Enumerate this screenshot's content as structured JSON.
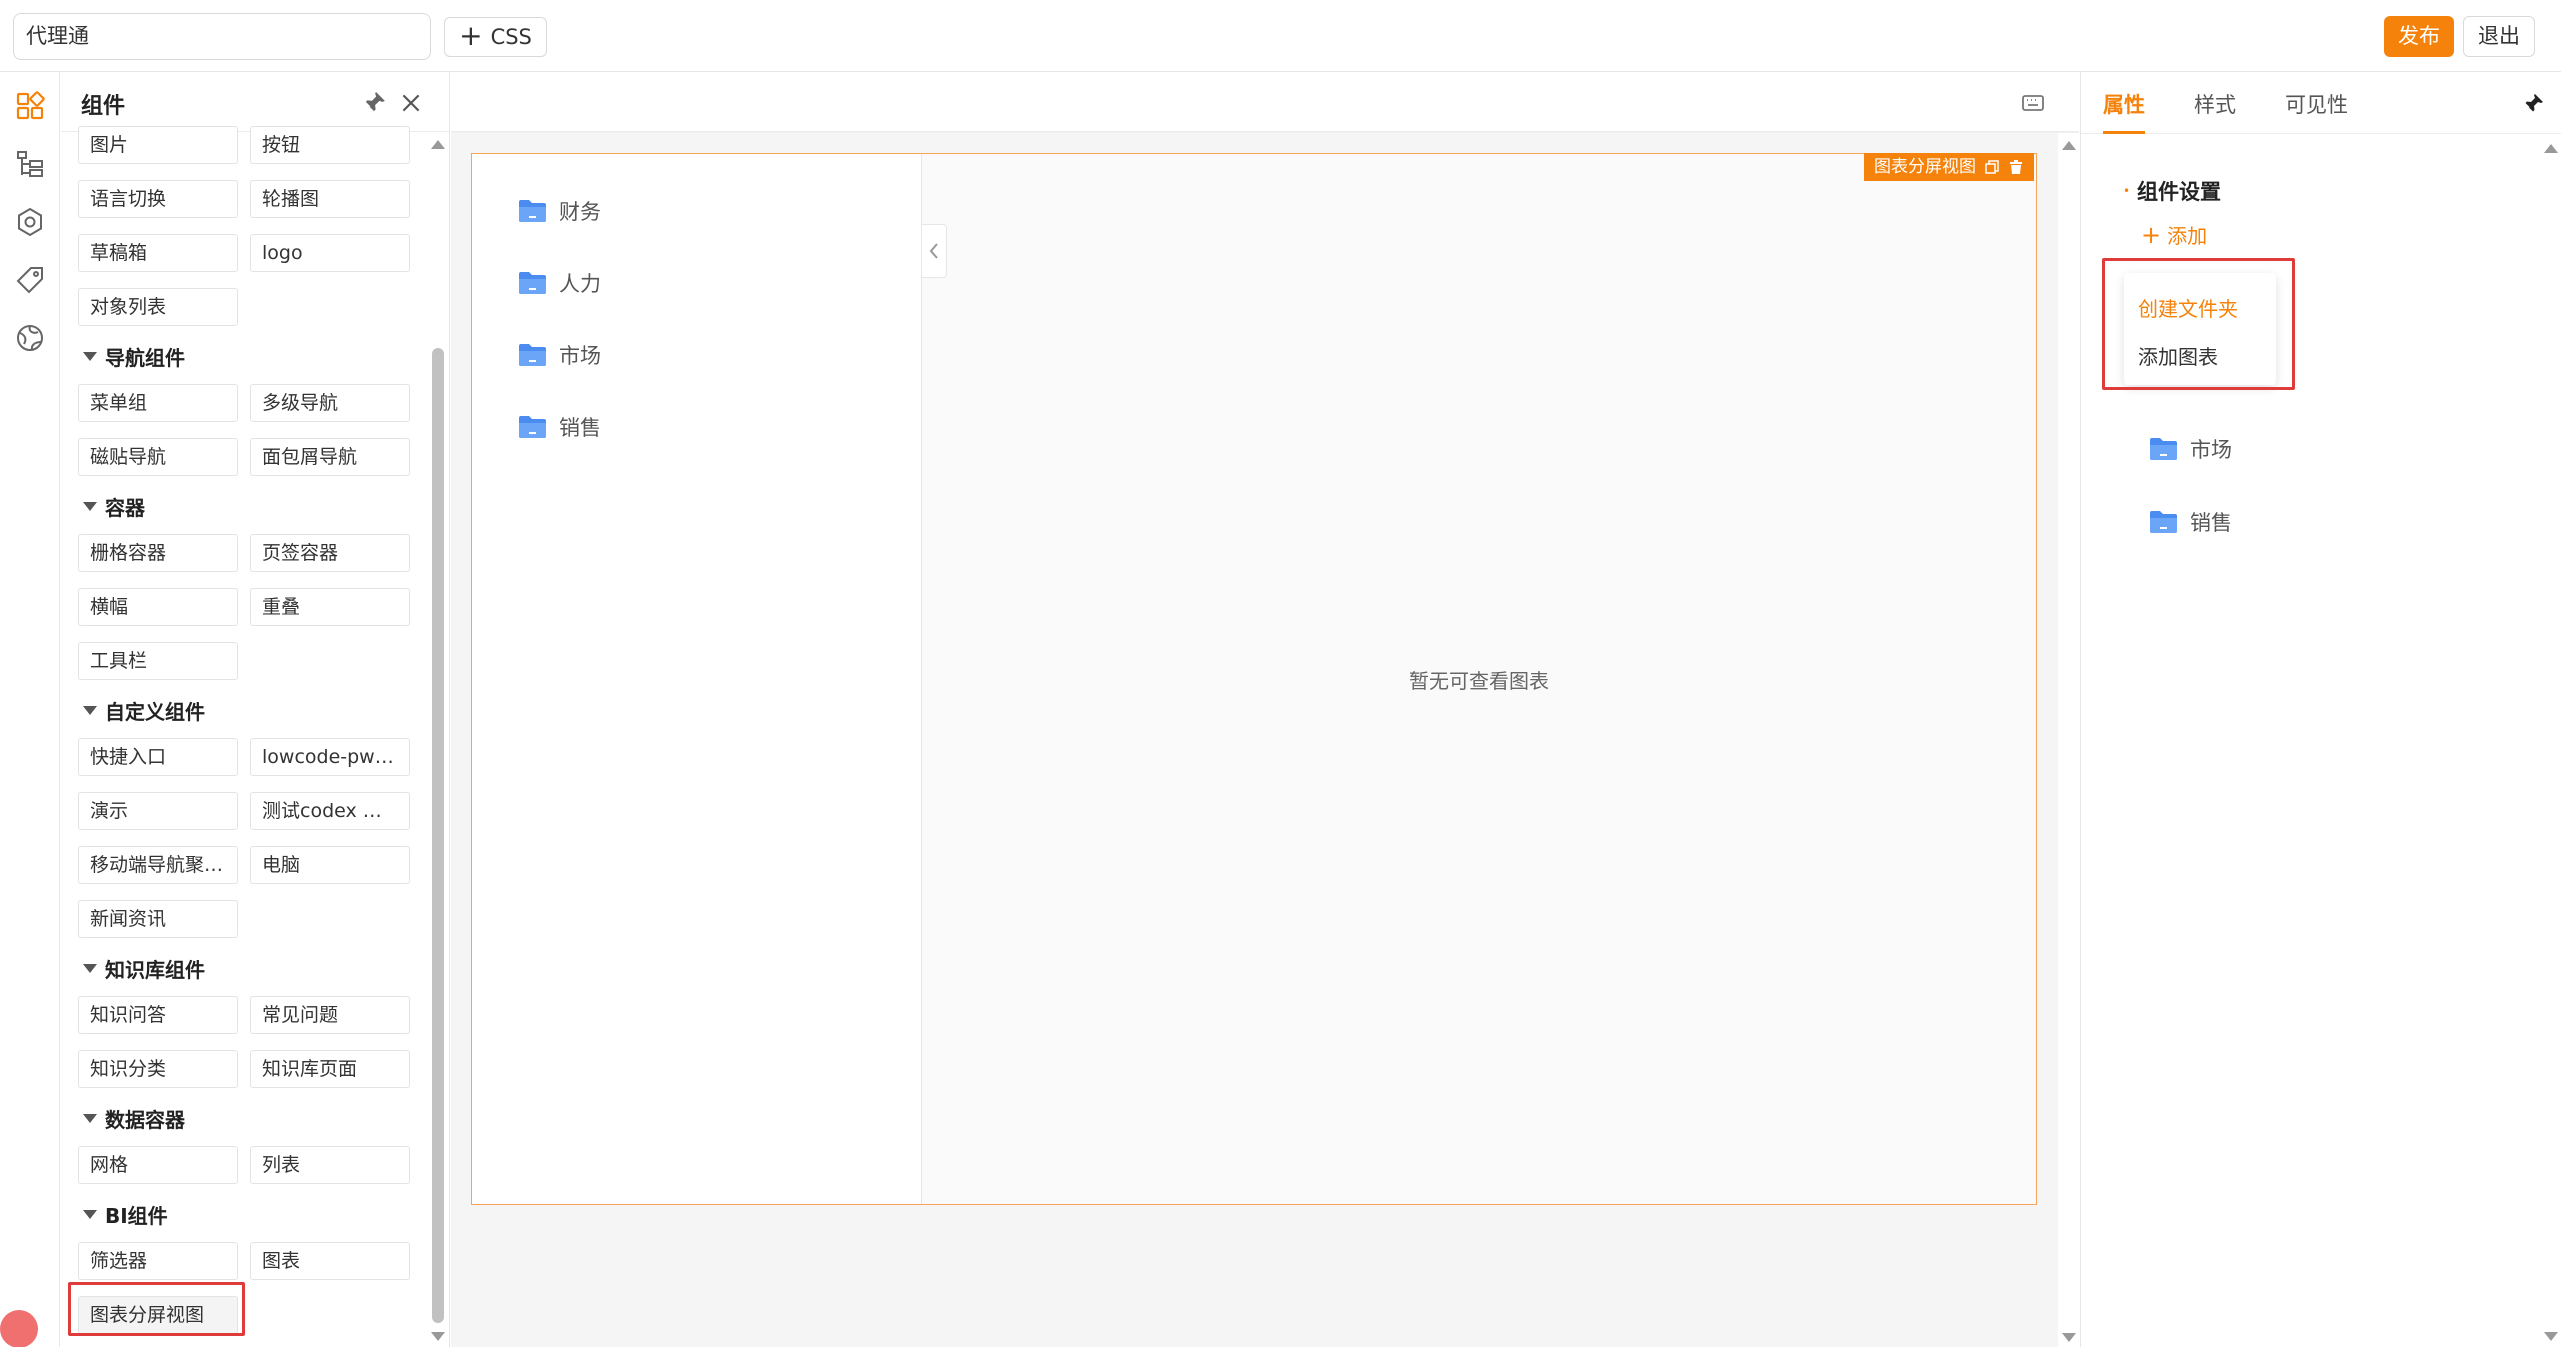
{
  "header": {
    "app_name": "代理通",
    "css_label": "CSS",
    "publish_label": "发布",
    "exit_label": "退出"
  },
  "rail": {
    "icons": [
      "components-icon",
      "tree-icon",
      "settings-hex-icon",
      "tag-icon",
      "globe-icon"
    ]
  },
  "panel": {
    "title": "组件",
    "top_items": [
      "图片",
      "按钮",
      "语言切换",
      "轮播图",
      "草稿箱",
      "logo",
      "对象列表"
    ],
    "groups": [
      {
        "title": "导航组件",
        "items": [
          "菜单组",
          "多级导航",
          "磁贴导航",
          "面包屑导航"
        ]
      },
      {
        "title": "容器",
        "items": [
          "栅格容器",
          "页签容器",
          "横幅",
          "重叠",
          "工具栏"
        ]
      },
      {
        "title": "自定义组件",
        "items": [
          "快捷入口",
          "lowcode-pwc-…",
          "演示",
          "测试codex 识…",
          "移动端导航聚…",
          "电脑",
          "新闻资讯"
        ]
      },
      {
        "title": "知识库组件",
        "items": [
          "知识问答",
          "常见问题",
          "知识分类",
          "知识库页面"
        ]
      },
      {
        "title": "数据容器",
        "items": [
          "网格",
          "列表"
        ]
      },
      {
        "title": "BI组件",
        "items": [
          "筛选器",
          "图表",
          "图表分屏视图"
        ]
      }
    ]
  },
  "canvas": {
    "selection_tag": "图表分屏视图",
    "folders": [
      "财务",
      "人力",
      "市场",
      "销售"
    ],
    "empty_text": "暂无可查看图表"
  },
  "props": {
    "tabs": [
      "属性",
      "样式",
      "可见性"
    ],
    "section_title": "组件设置",
    "add_label": "添加",
    "dropdown": [
      "创建文件夹",
      "添加图表"
    ],
    "folders": [
      "市场",
      "销售"
    ]
  },
  "colors": {
    "accent": "#f5820a",
    "highlight": "#e03b3b",
    "folder": "#4a8cf0"
  }
}
